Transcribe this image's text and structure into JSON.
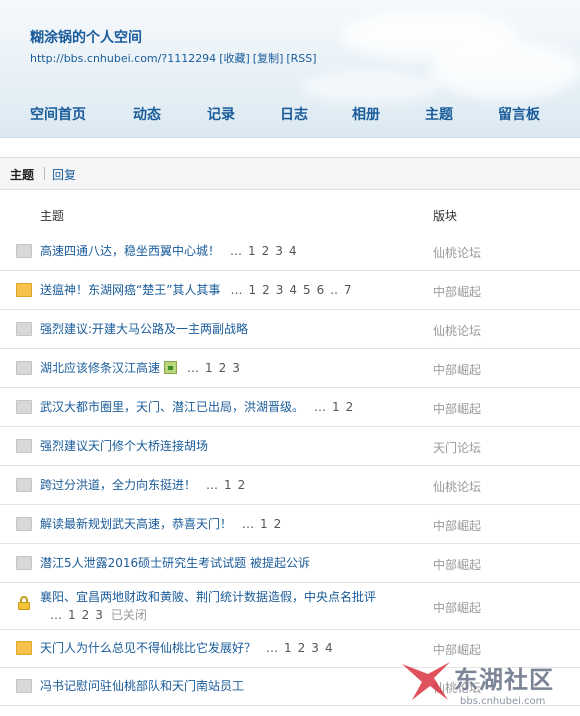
{
  "header": {
    "title": "糊涂锅的个人空间",
    "url": "http://bbs.cnhubei.com/?1112294",
    "link_favorite": "[收藏]",
    "link_copy": "[复制]",
    "link_rss": "[RSS]"
  },
  "nav": [
    "空间首页",
    "动态",
    "记录",
    "日志",
    "相册",
    "主题",
    "留言板"
  ],
  "tabs": {
    "active": "主题",
    "other": "回复"
  },
  "columns": {
    "subject": "主题",
    "forum": "版块"
  },
  "threads": [
    {
      "title": "高速四通八达，稳坐西翼中心城！",
      "pages": [
        "…",
        "1",
        "2",
        "3",
        "4"
      ],
      "forum": "仙桃论坛",
      "icon": "gray-folder-icon"
    },
    {
      "title": "送瘟神！东湖网癌“楚王”其人其事",
      "pages": [
        "…",
        "1",
        "2",
        "3",
        "4",
        "5",
        "6",
        "..",
        "7"
      ],
      "forum": "中部崛起",
      "icon": "orange-folder-icon"
    },
    {
      "title": "强烈建议:开建大马公路及一主两副战略",
      "pages": [],
      "forum": "仙桃论坛",
      "icon": "gray-folder-icon"
    },
    {
      "title": "湖北应该修条汉江高速",
      "image": true,
      "pages": [
        "…",
        "1",
        "2",
        "3"
      ],
      "forum": "中部崛起",
      "icon": "gray-folder-icon"
    },
    {
      "title": "武汉大都市圈里，天门、潜江已出局，洪湖晋级。",
      "pages": [
        "…",
        "1",
        "2"
      ],
      "forum": "中部崛起",
      "icon": "gray-folder-icon"
    },
    {
      "title": "强烈建议天门修个大桥连接胡场",
      "pages": [],
      "forum": "天门论坛",
      "icon": "gray-folder-icon"
    },
    {
      "title": "跨过分洪道，全力向东挺进！",
      "pages": [
        "…",
        "1",
        "2"
      ],
      "forum": "仙桃论坛",
      "icon": "gray-folder-icon"
    },
    {
      "title": "解读最新规划武天高速，恭喜天门！",
      "pages": [
        "…",
        "1",
        "2"
      ],
      "forum": "中部崛起",
      "icon": "gray-folder-icon"
    },
    {
      "title": "潜江5人泄露2016硕士研究生考试试题 被提起公诉",
      "pages": [],
      "forum": "中部崛起",
      "icon": "gray-folder-icon"
    },
    {
      "title": "襄阳、宜昌两地财政和黄陂、荆门统计数据造假，中央点名批评",
      "pages": [
        "…",
        "1",
        "2",
        "3"
      ],
      "closed": "已关闭",
      "forum": "中部崛起",
      "icon": "lock-icon"
    },
    {
      "title": "天门人为什么总见不得仙桃比它发展好？",
      "pages": [
        "…",
        "1",
        "2",
        "3",
        "4"
      ],
      "forum": "中部崛起",
      "icon": "orange-folder-icon"
    },
    {
      "title": "冯书记慰问驻仙桃部队和天门南站员工",
      "pages": [],
      "forum": "仙桃论坛",
      "icon": "gray-folder-icon"
    }
  ],
  "watermark": {
    "name": "东湖社区",
    "url": "bbs.cnhubei.com"
  },
  "colors": {
    "link": "#1a5c9a",
    "forum": "#9a9a9a",
    "folder_gray": "#d8d8d8",
    "folder_orange": "#f6c24c"
  }
}
